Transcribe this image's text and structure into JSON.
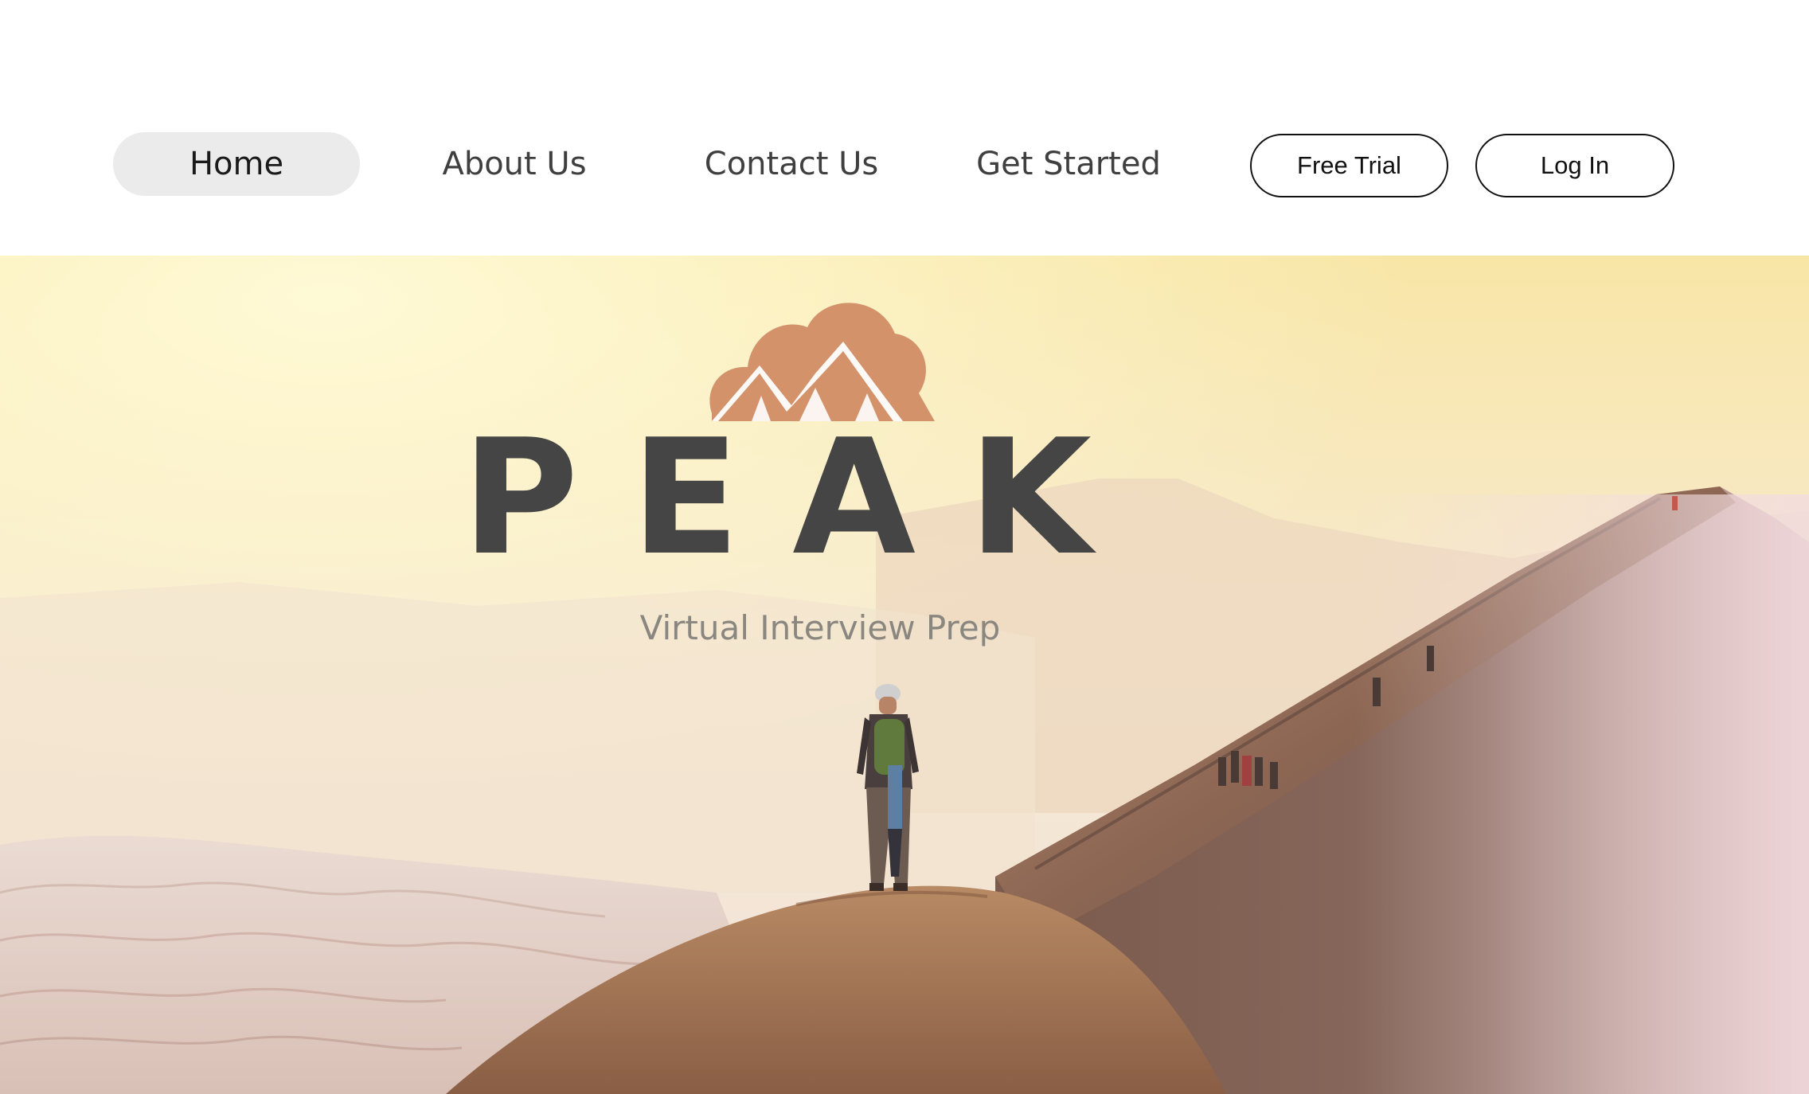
{
  "nav": {
    "items": [
      {
        "label": "Home",
        "active": true
      },
      {
        "label": "About Us",
        "active": false
      },
      {
        "label": "Contact Us",
        "active": false
      },
      {
        "label": "Get Started",
        "active": false
      }
    ],
    "free_trial_label": "Free Trial",
    "login_label": "Log In"
  },
  "hero": {
    "logo_icon": "mountain-cloud-icon",
    "title": "PEAK",
    "subtitle": "Virtual Interview Prep",
    "image": "hikers-on-mountain-ridge"
  },
  "colors": {
    "logo_orange": "#d4926a",
    "title_dark": "#454545",
    "subtitle_gray": "#8a8680",
    "nav_active_bg": "#ebebeb"
  }
}
